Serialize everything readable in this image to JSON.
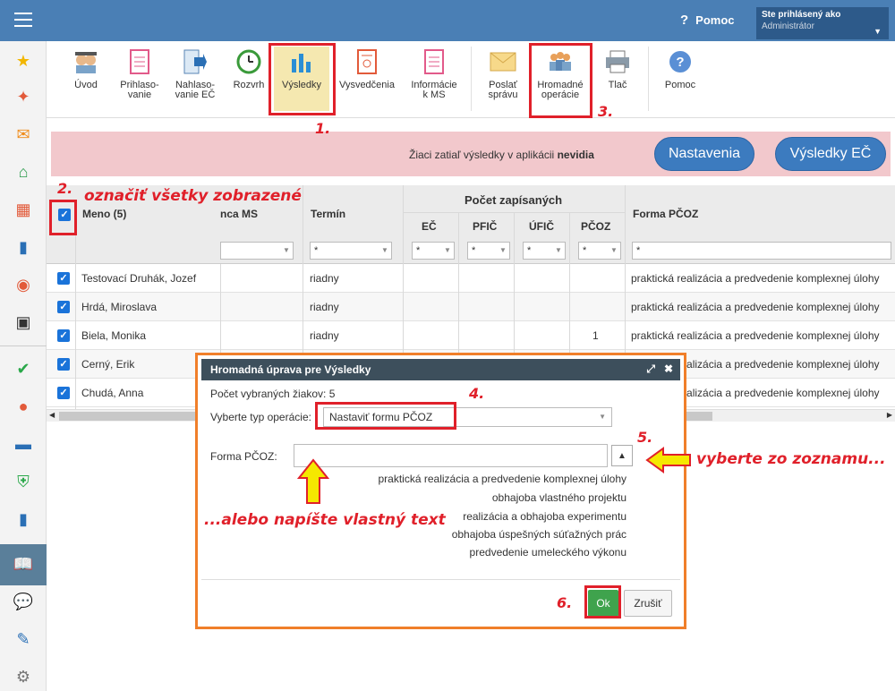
{
  "header": {
    "help_label": "Pomoc",
    "user_line1": "Ste prihlásený ako",
    "user_line2": "Administrátor"
  },
  "toolbar": {
    "items": [
      {
        "label1": "Úvod",
        "label2": "",
        "icon": "students-icon"
      },
      {
        "label1": "Prihlaso-",
        "label2": "vanie",
        "icon": "form-icon"
      },
      {
        "label1": "Nahlaso-",
        "label2": "vanie EČ",
        "icon": "send-icon"
      },
      {
        "label1": "Rozvrh",
        "label2": "",
        "icon": "clock-icon"
      },
      {
        "label1": "Výsledky",
        "label2": "",
        "icon": "chart-icon"
      },
      {
        "label1": "Vysvedčenia",
        "label2": "",
        "icon": "certificate-icon"
      },
      {
        "label1": "Informácie",
        "label2": "k MS",
        "icon": "info-doc-icon"
      },
      {
        "label1": "Poslať",
        "label2": "správu",
        "icon": "envelope-icon"
      },
      {
        "label1": "Hromadné",
        "label2": "operácie",
        "icon": "group-icon"
      },
      {
        "label1": "Tlač",
        "label2": "",
        "icon": "printer-icon"
      },
      {
        "label1": "Pomoc",
        "label2": "",
        "icon": "help-icon"
      }
    ]
  },
  "banner": {
    "text_prefix": "Žiaci zatiaľ výsledky v aplikácii ",
    "text_bold": "nevidia",
    "btn_settings": "Nastavenia",
    "btn_results": "Výsledky EČ"
  },
  "grid": {
    "group_header": "Počet zapísaných",
    "col_name": "Meno (5)",
    "col_ms": "nca MS",
    "col_term": "Termín",
    "col_ec": "EČ",
    "col_pfic": "PFIČ",
    "col_ufic": "ÚFIČ",
    "col_pcoz": "PČOZ",
    "col_forma": "Forma PČOZ",
    "filter_star": "*",
    "rows": [
      {
        "name": "Testovací Druhák, Jozef",
        "term": "riadny",
        "pcoz": "",
        "forma": "praktická realizácia a predvedenie komplexnej úlohy"
      },
      {
        "name": "Hrdá, Miroslava",
        "term": "riadny",
        "pcoz": "",
        "forma": "praktická realizácia a predvedenie komplexnej úlohy"
      },
      {
        "name": "Biela, Monika",
        "term": "riadny",
        "pcoz": "1",
        "forma": "praktická realizácia a predvedenie komplexnej úlohy"
      },
      {
        "name": "Cerný, Erik",
        "term": "",
        "pcoz": "",
        "forma": "praktická realizácia a predvedenie komplexnej úlohy"
      },
      {
        "name": "Chudá, Anna",
        "term": "",
        "pcoz": "",
        "forma": "praktická realizácia a predvedenie komplexnej úlohy"
      }
    ]
  },
  "modal": {
    "title": "Hromadná úprava pre Výsledky",
    "count_label": "Počet vybraných žiakov: 5",
    "op_label": "Vyberte typ operácie:",
    "op_value": "Nastaviť formu PČOZ",
    "forma_label": "Forma PČOZ:",
    "forma_value": "",
    "options": [
      "praktická realizácia a predvedenie komplexnej úlohy",
      "obhajoba vlastného projektu",
      "realizácia a obhajoba experimentu",
      "obhajoba úspešných súťažných prác",
      "predvedenie umeleckého výkonu"
    ],
    "ok_label": "Ok",
    "cancel_label": "Zrušiť"
  },
  "annotations": {
    "step1": "1.",
    "step2": "2.",
    "step2_text": "označiť všetky zobrazené",
    "step3": "3.",
    "step4": "4.",
    "step5": "5.",
    "step5_text": "vyberte zo zoznamu...",
    "step6": "6.",
    "write_text": "...alebo napíšte vlastný text"
  },
  "colors": {
    "topbar": "#4a7fb5",
    "annotation_red": "#e0202a",
    "modal_border": "#f07f2a",
    "arrow_yellow": "#f5e800",
    "ok_green": "#3fa34d"
  }
}
